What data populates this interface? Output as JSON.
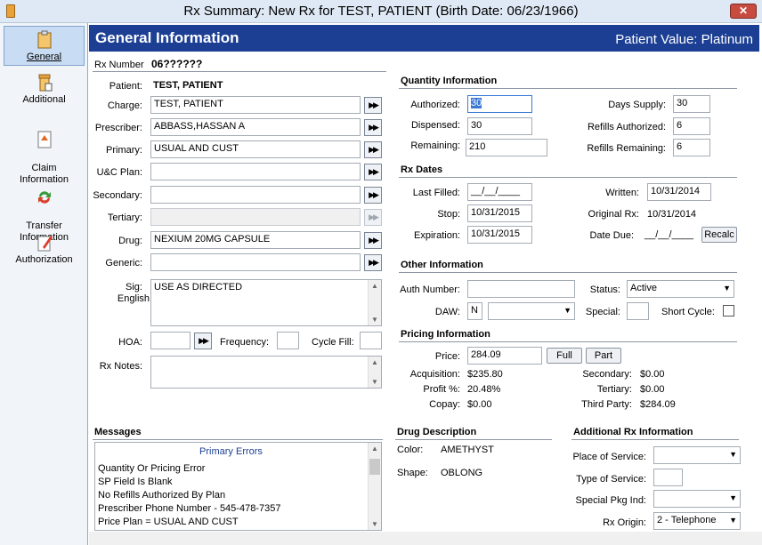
{
  "window": {
    "title": "Rx Summary: New Rx for TEST, PATIENT (Birth Date: 06/23/1966)",
    "close": "✕"
  },
  "sidebar": {
    "items": [
      {
        "label": "General"
      },
      {
        "label": "Additional"
      },
      {
        "label": "Claim\nInformation"
      },
      {
        "label": "Transfer\nInformation"
      },
      {
        "label": "Authorization"
      }
    ]
  },
  "header": {
    "title": "General Information",
    "patient_value": "Patient Value: Platinum"
  },
  "rx": {
    "number_label": "Rx Number",
    "number": "06??????"
  },
  "patient": {
    "label": "Patient:",
    "value": "TEST, PATIENT"
  },
  "fields": {
    "charge": {
      "label": "Charge:",
      "value": "TEST, PATIENT"
    },
    "prescriber": {
      "label": "Prescriber:",
      "value": "ABBASS,HASSAN A"
    },
    "primary": {
      "label": "Primary:",
      "value": "USUAL AND CUST"
    },
    "uc_plan": {
      "label": "U&C Plan:",
      "value": ""
    },
    "secondary": {
      "label": "Secondary:",
      "value": ""
    },
    "tertiary": {
      "label": "Tertiary:",
      "value": ""
    },
    "drug": {
      "label": "Drug:",
      "value": "NEXIUM 20MG CAPSULE"
    },
    "generic": {
      "label": "Generic:",
      "value": ""
    },
    "sig": {
      "label": "Sig:",
      "sublabel": "English",
      "value": "USE AS DIRECTED"
    },
    "hoa": {
      "label": "HOA:",
      "value": ""
    },
    "frequency": {
      "label": "Frequency:",
      "value": ""
    },
    "cycle_fill": {
      "label": "Cycle Fill:",
      "value": ""
    },
    "rx_notes": {
      "label": "Rx Notes:",
      "value": ""
    }
  },
  "quantity": {
    "title": "Quantity Information",
    "authorized": {
      "label": "Authorized:",
      "value": "30"
    },
    "dispensed": {
      "label": "Dispensed:",
      "value": "30"
    },
    "remaining": {
      "label": "Remaining:",
      "value": "210"
    },
    "days_supply": {
      "label": "Days Supply:",
      "value": "30"
    },
    "refills_authorized": {
      "label": "Refills Authorized:",
      "value": "6"
    },
    "refills_remaining": {
      "label": "Refills Remaining:",
      "value": "6"
    }
  },
  "dates": {
    "title": "Rx Dates",
    "last_filled": {
      "label": "Last Filled:",
      "value": "__/__/____"
    },
    "stop": {
      "label": "Stop:",
      "value": "10/31/2015"
    },
    "expiration": {
      "label": "Expiration:",
      "value": "10/31/2015"
    },
    "written": {
      "label": "Written:",
      "value": "10/31/2014"
    },
    "original_rx": {
      "label": "Original Rx:",
      "value": "10/31/2014"
    },
    "date_due": {
      "label": "Date Due:",
      "value": "__/__/____"
    },
    "recalc": "Recalc"
  },
  "other": {
    "title": "Other Information",
    "auth_number": {
      "label": "Auth Number:",
      "value": ""
    },
    "daw": {
      "label": "DAW:",
      "value": "N",
      "select": ""
    },
    "status": {
      "label": "Status:",
      "value": "Active"
    },
    "special": {
      "label": "Special:",
      "value": ""
    },
    "short_cycle": {
      "label": "Short Cycle:"
    }
  },
  "pricing": {
    "title": "Pricing Information",
    "price": {
      "label": "Price:",
      "value": "284.09"
    },
    "full": "Full",
    "part": "Part",
    "acquisition": {
      "label": "Acquisition:",
      "value": "$235.80"
    },
    "profit": {
      "label": "Profit %:",
      "value": "20.48%"
    },
    "copay": {
      "label": "Copay:",
      "value": "$0.00"
    },
    "secondary": {
      "label": "Secondary:",
      "value": "$0.00"
    },
    "tertiary": {
      "label": "Tertiary:",
      "value": "$0.00"
    },
    "third_party": {
      "label": "Third Party:",
      "value": "$284.09"
    }
  },
  "messages": {
    "title": "Messages",
    "header": "Primary Errors",
    "lines": [
      "Quantity Or Pricing Error",
      "SP Field Is Blank",
      "No Refills Authorized By Plan",
      "Prescriber Phone Number - 545-478-7357",
      "Price Plan = USUAL AND CUST"
    ]
  },
  "drug_description": {
    "title": "Drug Description",
    "color": {
      "label": "Color:",
      "value": "AMETHYST"
    },
    "shape": {
      "label": "Shape:",
      "value": "OBLONG"
    }
  },
  "additional_rx": {
    "title": "Additional Rx Information",
    "place_of_service": {
      "label": "Place of Service:",
      "value": ""
    },
    "type_of_service": {
      "label": "Type of Service:",
      "value": ""
    },
    "special_pkg": {
      "label": "Special Pkg Ind:",
      "value": ""
    },
    "rx_origin": {
      "label": "Rx Origin:",
      "value": "2 - Telephone"
    }
  },
  "colors": {
    "header": "#1c3f94",
    "sidebar_active": "#c8dcf3",
    "title_bar": "#dfe9f5"
  }
}
